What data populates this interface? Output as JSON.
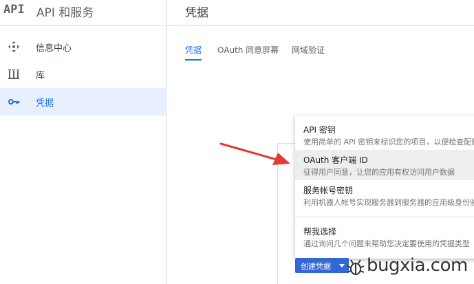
{
  "brand": {
    "logo": "API",
    "title": "API 和服务"
  },
  "sidebar": {
    "items": [
      {
        "label": "信息中心",
        "icon": "dashboard-icon",
        "active": false
      },
      {
        "label": "库",
        "icon": "library-icon",
        "active": false
      },
      {
        "label": "凭据",
        "icon": "key-icon",
        "active": true
      }
    ]
  },
  "header": {
    "title": "凭据"
  },
  "tabs": [
    {
      "label": "凭据",
      "active": true
    },
    {
      "label": "OAuth 同意屏幕",
      "active": false
    },
    {
      "label": "网域验证",
      "active": false
    }
  ],
  "dropdown": {
    "items": [
      {
        "title": "API 密钥",
        "desc": "使用简单的 API 密钥来标识您的项目，以便检查配额和访问权限"
      },
      {
        "title": "OAuth 客户端 ID",
        "desc": "征得用户同意，让您的应用有权访问用户数据"
      },
      {
        "title": "服务帐号密钥",
        "desc": "利用机器人帐号实现服务器到服务器的应用级身份验证"
      },
      {
        "title": "帮我选择",
        "desc": "通过询问几个问题来帮助您决定要使用的凭据类型"
      }
    ]
  },
  "create_button": {
    "label": "创建凭据"
  },
  "watermark": {
    "text": "bugxia.com"
  },
  "colors": {
    "accent": "#1a73e8",
    "button": "#3367d6",
    "arrow": "#e53935"
  }
}
